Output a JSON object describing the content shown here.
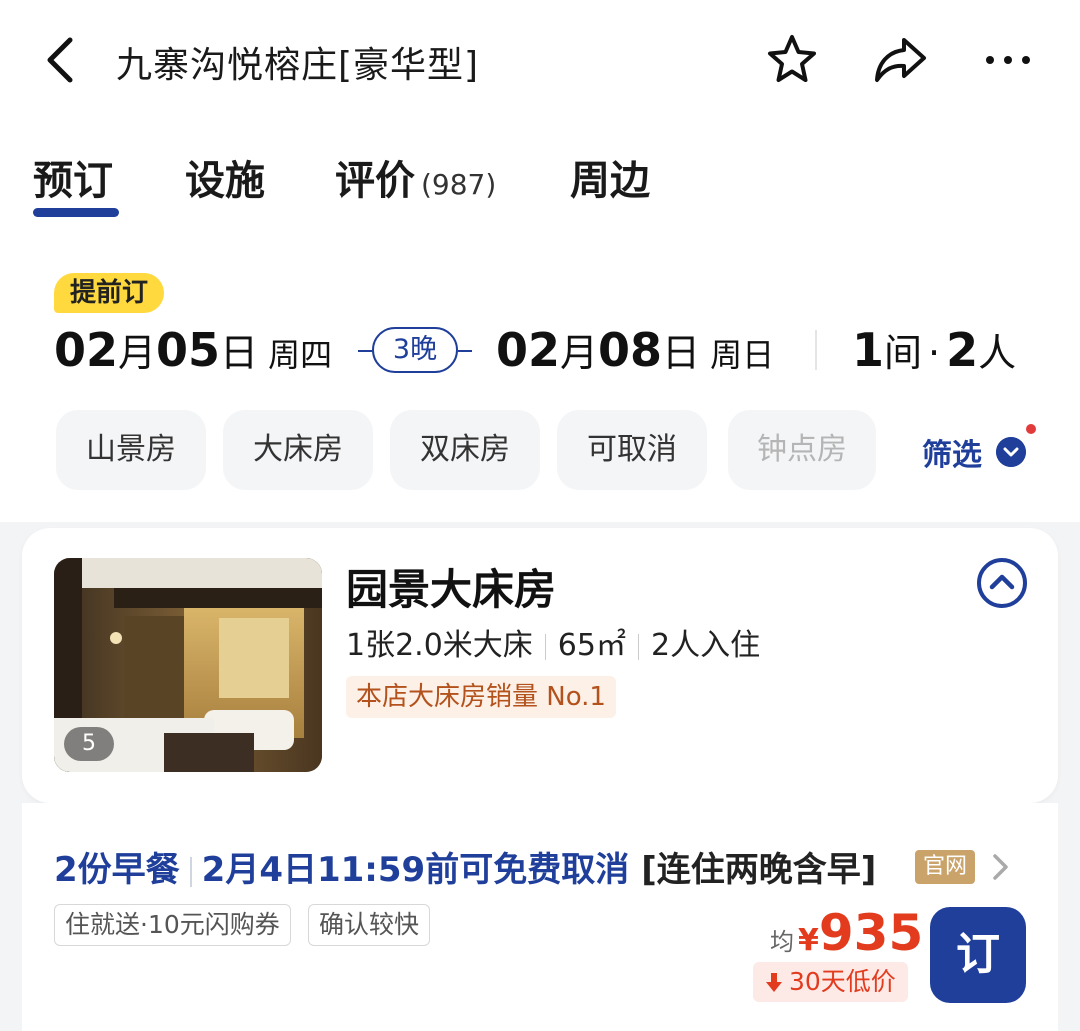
{
  "header": {
    "title": "九寨沟悦榕庄[豪华型]",
    "icons": [
      "back-arrow-icon",
      "star-icon",
      "share-icon",
      "more-icon"
    ]
  },
  "tabs": [
    {
      "label": "预订",
      "active": true
    },
    {
      "label": "设施"
    },
    {
      "label": "评价",
      "count": "(987)"
    },
    {
      "label": "周边"
    }
  ],
  "stay": {
    "badge": "提前订",
    "checkin": {
      "month": "02",
      "month_unit": "月",
      "day": "05",
      "day_unit": "日",
      "weekday": "周四"
    },
    "nights": "3晚",
    "checkout": {
      "month": "02",
      "month_unit": "月",
      "day": "08",
      "day_unit": "日",
      "weekday": "周日"
    },
    "rooms": {
      "count": "1",
      "unit": "间",
      "sep": "·",
      "guests": "2",
      "guests_unit": "人"
    }
  },
  "filters": {
    "chips": [
      "山景房",
      "大床房",
      "双床房",
      "可取消",
      "钟点房"
    ],
    "filter_label": "筛选"
  },
  "room": {
    "name": "园景大床房",
    "bed": "1张2.0米大床",
    "area": "65㎡",
    "occupancy": "2人入住",
    "tag": "本店大床房销量 No.1",
    "image_count": "5"
  },
  "rate": {
    "breakfast": "2份早餐",
    "cancel": "2月4日11:59前可免费取消",
    "package": "[连住两晚含早]",
    "official_badge": "官网",
    "perks": [
      "住就送·10元闪购券",
      "确认较快"
    ],
    "avg_label": "均",
    "currency": "¥",
    "price": "935",
    "low_price_tag": "30天低价",
    "book_label": "订"
  },
  "colors": {
    "brand_blue": "#1f3f9b",
    "price_red": "#e23b1e",
    "badge_yellow": "#ffd93d",
    "official_gold": "#c9a36a"
  }
}
